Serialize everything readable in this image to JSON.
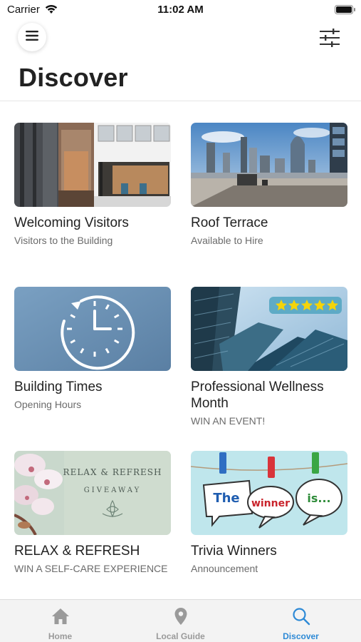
{
  "status_bar": {
    "carrier": "Carrier",
    "time": "11:02 AM"
  },
  "header": {
    "title": "Discover"
  },
  "cards": [
    {
      "title": "Welcoming Visitors",
      "subtitle": "Visitors to the Building",
      "image": "building-lobby"
    },
    {
      "title": "Roof Terrace",
      "subtitle": "Available to Hire",
      "image": "city-skyline"
    },
    {
      "title": "Building Times",
      "subtitle": "Opening Hours",
      "image": "clock-icon"
    },
    {
      "title": "Professional Wellness Month",
      "subtitle": "WIN AN EVENT!",
      "image": "glass-towers-five-stars"
    },
    {
      "title": "RELAX & REFRESH",
      "subtitle": "WIN A SELF-CARE EXPERIENCE",
      "image": "orchid-giveaway",
      "image_text": {
        "line1": "RELAX & REFRESH",
        "line2": "GIVEAWAY"
      }
    },
    {
      "title": "Trivia Winners",
      "subtitle": "Announcement",
      "image": "speech-bubbles-clothespins",
      "image_text": {
        "bubble1": "The",
        "bubble2": "winner",
        "bubble3": "is..."
      }
    }
  ],
  "tab_bar": {
    "tabs": [
      {
        "label": "Home",
        "icon": "home-icon"
      },
      {
        "label": "Local Guide",
        "icon": "location-pin-icon"
      },
      {
        "label": "Discover",
        "icon": "search-icon"
      }
    ],
    "active": "Discover"
  },
  "colors": {
    "accent": "#2e8ad6",
    "inactive": "#9a9a9a",
    "clock_bg": "#6a8fb3"
  }
}
